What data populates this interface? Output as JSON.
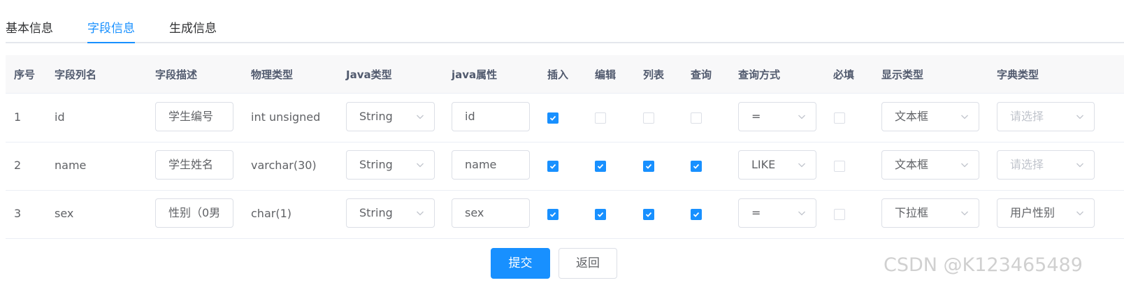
{
  "tabs": [
    "基本信息",
    "字段信息",
    "生成信息"
  ],
  "active_tab": "字段信息",
  "table": {
    "headers": [
      "序号",
      "字段列名",
      "字段描述",
      "物理类型",
      "Java类型",
      "java属性",
      "插入",
      "编辑",
      "列表",
      "查询",
      "查询方式",
      "必填",
      "显示类型",
      "字典类型"
    ],
    "rows": [
      {
        "index": "1",
        "column": "id",
        "description": "学生编号",
        "physical_type": "int unsigned",
        "java_type": "String",
        "java_field": "id",
        "insert": true,
        "edit": false,
        "list": false,
        "query": false,
        "query_type": "=",
        "required": false,
        "html_type": "文本框",
        "dict_type": "请选择",
        "dict_placeholder": true
      },
      {
        "index": "2",
        "column": "name",
        "description": "学生姓名",
        "physical_type": "varchar(30)",
        "java_type": "String",
        "java_field": "name",
        "insert": true,
        "edit": true,
        "list": true,
        "query": true,
        "query_type": "LIKE",
        "required": false,
        "html_type": "文本框",
        "dict_type": "请选择",
        "dict_placeholder": true
      },
      {
        "index": "3",
        "column": "sex",
        "description": "性别（0男",
        "physical_type": "char(1)",
        "java_type": "String",
        "java_field": "sex",
        "insert": true,
        "edit": true,
        "list": true,
        "query": true,
        "query_type": "=",
        "required": false,
        "html_type": "下拉框",
        "dict_type": "用户性别",
        "dict_placeholder": false
      }
    ]
  },
  "buttons": {
    "submit": "提交",
    "back": "返回"
  },
  "watermark": "CSDN @K123465489",
  "colors": {
    "accent": "#1890ff",
    "border": "#dcdfe6",
    "header_bg": "#f8f8f9"
  },
  "icons": {
    "select_arrow": "chevron-down-icon",
    "checked": "check-icon"
  }
}
